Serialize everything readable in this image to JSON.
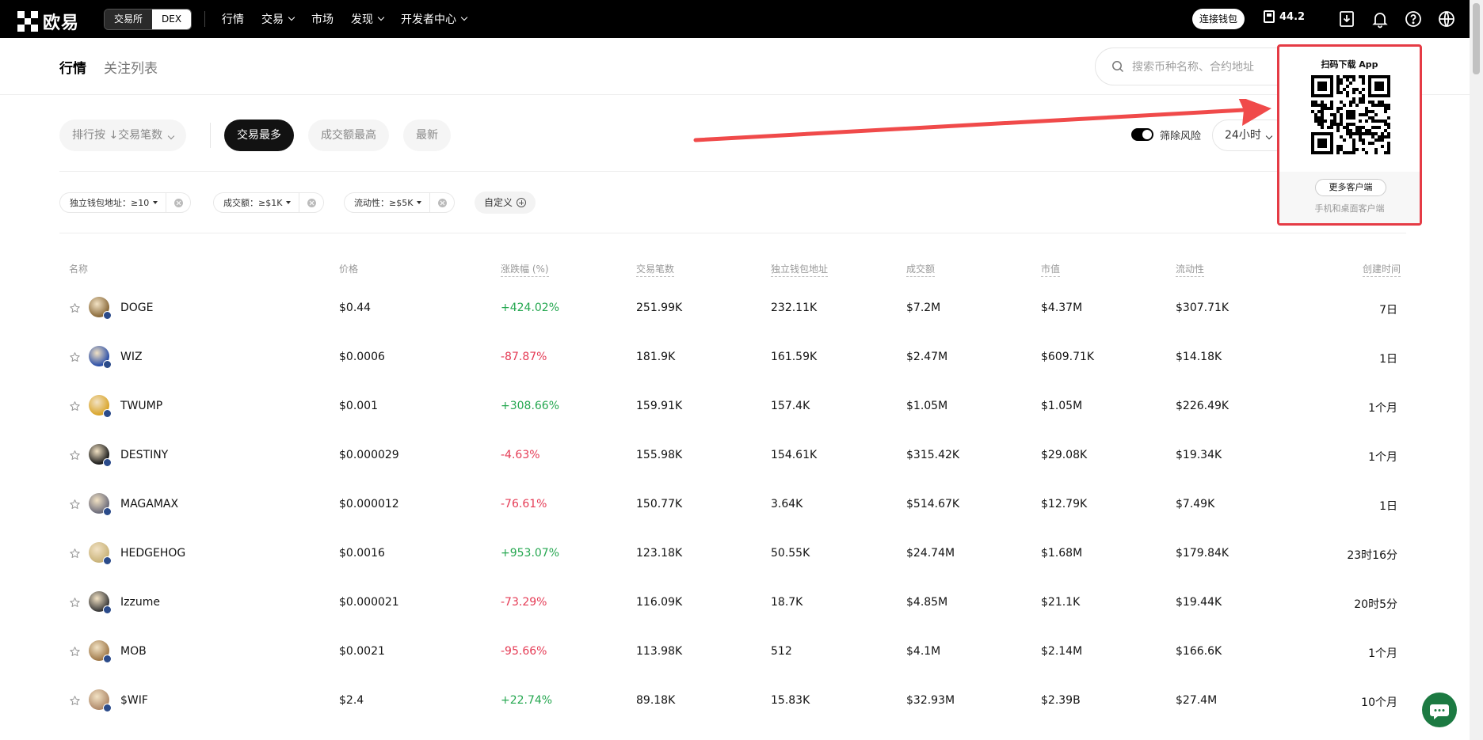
{
  "nav": {
    "logo": "欧易",
    "segment": [
      "交易所",
      "DEX"
    ],
    "links": [
      {
        "label": "行情",
        "dropdown": false
      },
      {
        "label": "交易",
        "dropdown": true
      },
      {
        "label": "市场",
        "dropdown": false
      },
      {
        "label": "发现",
        "dropdown": true
      },
      {
        "label": "开发者中心",
        "dropdown": true
      }
    ],
    "connect_wallet": "连接钱包",
    "gas_value": "44.2",
    "icons": [
      "download-icon",
      "bell-icon",
      "help-icon",
      "globe-icon"
    ]
  },
  "subheader": {
    "tab_market": "行情",
    "tab_watchlist": "关注列表",
    "search_placeholder": "搜索币种名称、合约地址"
  },
  "filters": {
    "sort_by": "排行按 ↓交易笔数",
    "pills": [
      "交易最多",
      "成交额最高",
      "最新"
    ],
    "active_pill": "交易最多",
    "risk_toggle_label": "筛除风险",
    "risk_toggle_on": true,
    "time_range": "24小时",
    "chips": [
      {
        "label": "独立钱包地址：≥10"
      },
      {
        "label": "成交额：≥$1K"
      },
      {
        "label": "流动性：≥$5K"
      }
    ],
    "custom": "自定义"
  },
  "table": {
    "headers": [
      "名称",
      "价格",
      "涨跌幅 (%)",
      "交易笔数",
      "独立钱包地址",
      "成交额",
      "市值",
      "流动性",
      "创建时间"
    ],
    "rows": [
      {
        "name": "DOGE",
        "price": "$0.44",
        "change": "+424.02%",
        "dir": "pos",
        "txs": "251.99K",
        "wallets": "232.11K",
        "volume": "$7.2M",
        "mcap": "$4.37M",
        "liquidity": "$307.71K",
        "created": "7日",
        "avatar_color": "#8a6a3a"
      },
      {
        "name": "WIZ",
        "price": "$0.0006",
        "change": "-87.87%",
        "dir": "neg",
        "txs": "181.9K",
        "wallets": "161.59K",
        "volume": "$2.47M",
        "mcap": "$609.71K",
        "liquidity": "$14.18K",
        "created": "1日",
        "avatar_color": "#2a4ea8"
      },
      {
        "name": "TWUMP",
        "price": "$0.001",
        "change": "+308.66%",
        "dir": "pos",
        "txs": "159.91K",
        "wallets": "157.4K",
        "volume": "$1.05M",
        "mcap": "$1.05M",
        "liquidity": "$226.49K",
        "created": "1个月",
        "avatar_color": "#d9a52a"
      },
      {
        "name": "DESTINY",
        "price": "$0.000029",
        "change": "-4.63%",
        "dir": "neg",
        "txs": "155.98K",
        "wallets": "154.61K",
        "volume": "$315.42K",
        "mcap": "$29.08K",
        "liquidity": "$19.34K",
        "created": "1个月",
        "avatar_color": "#1a1a1a"
      },
      {
        "name": "MAGAMAX",
        "price": "$0.000012",
        "change": "-76.61%",
        "dir": "neg",
        "txs": "150.77K",
        "wallets": "3.64K",
        "volume": "$514.67K",
        "mcap": "$12.79K",
        "liquidity": "$7.49K",
        "created": "1日",
        "avatar_color": "#6b6b7a"
      },
      {
        "name": "HEDGEHOG",
        "price": "$0.0016",
        "change": "+953.07%",
        "dir": "pos",
        "txs": "123.18K",
        "wallets": "50.55K",
        "volume": "$24.74M",
        "mcap": "$1.68M",
        "liquidity": "$179.84K",
        "created": "23时16分",
        "avatar_color": "#c9b37a"
      },
      {
        "name": "Izzume",
        "price": "$0.000021",
        "change": "-73.29%",
        "dir": "neg",
        "txs": "116.09K",
        "wallets": "18.7K",
        "volume": "$4.85M",
        "mcap": "$21.1K",
        "liquidity": "$19.44K",
        "created": "20时5分",
        "avatar_color": "#3a3a3a"
      },
      {
        "name": "MOB",
        "price": "$0.0021",
        "change": "-95.66%",
        "dir": "neg",
        "txs": "113.98K",
        "wallets": "512",
        "volume": "$4.1M",
        "mcap": "$2.14M",
        "liquidity": "$166.6K",
        "created": "1个月",
        "avatar_color": "#a07a4a"
      },
      {
        "name": "$WIF",
        "price": "$2.4",
        "change": "+22.74%",
        "dir": "pos",
        "txs": "89.18K",
        "wallets": "15.83K",
        "volume": "$32.93M",
        "mcap": "$2.39B",
        "liquidity": "$27.4M",
        "created": "10个月",
        "avatar_color": "#b08a6a"
      }
    ]
  },
  "qr_popup": {
    "title": "扫码下载 App",
    "more_button": "更多客户端",
    "subtitle": "手机和桌面客户端"
  },
  "colors": {
    "positive": "#25a750",
    "negative": "#e53b55",
    "annotation_red": "#e53b45"
  }
}
